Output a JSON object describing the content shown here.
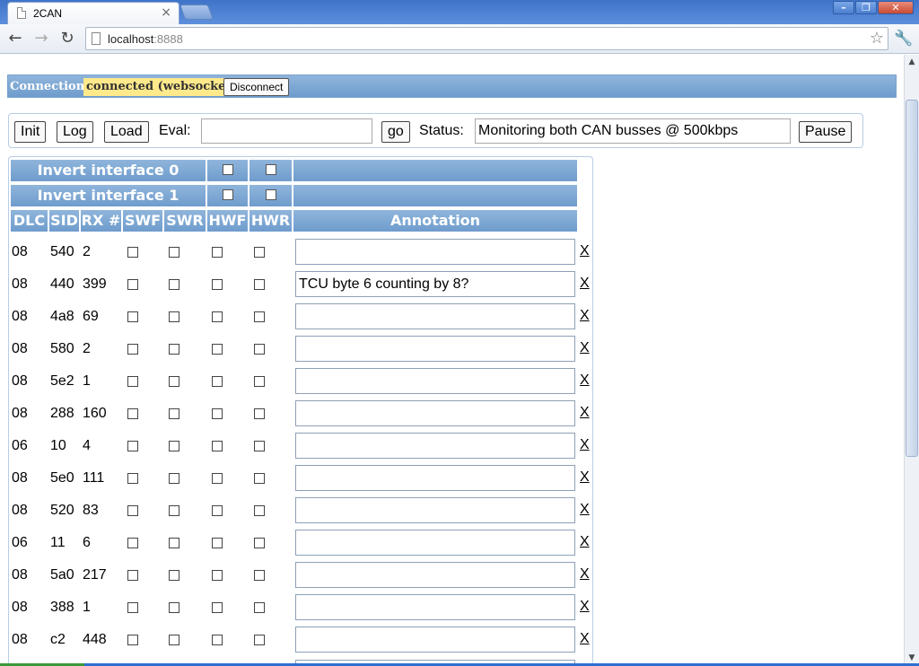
{
  "browser": {
    "tab_title": "2CAN",
    "tab_close": "×",
    "url_host": "localhost",
    "url_port": ":8888",
    "back": "←",
    "forward": "→",
    "reload": "↻",
    "star": "☆",
    "wrench": "🔧",
    "min": "–",
    "max": "❐",
    "close": "✕"
  },
  "connection": {
    "label": "Connection:",
    "status": "connected (websocket)",
    "button": "Disconnect"
  },
  "controls": {
    "init": "Init",
    "log": "Log",
    "load": "Load",
    "eval_label": "Eval:",
    "eval_value": "",
    "go": "go",
    "status_label": "Status:",
    "status_value": "Monitoring both CAN busses @ 500kbps",
    "pause": "Pause"
  },
  "table": {
    "invert0": "Invert interface 0",
    "invert1": "Invert interface 1",
    "headers": {
      "dlc": "DLC",
      "sid": "SID",
      "rx": "RX #",
      "swf": "SWF",
      "swr": "SWR",
      "hwf": "HWF",
      "hwr": "HWR",
      "annotation": "Annotation"
    },
    "delete_label": "X",
    "rows": [
      {
        "dlc": "08",
        "sid": "540",
        "rx": "2",
        "annotation": ""
      },
      {
        "dlc": "08",
        "sid": "440",
        "rx": "399",
        "annotation": "TCU byte 6 counting by 8?"
      },
      {
        "dlc": "08",
        "sid": "4a8",
        "rx": "69",
        "annotation": ""
      },
      {
        "dlc": "08",
        "sid": "580",
        "rx": "2",
        "annotation": ""
      },
      {
        "dlc": "08",
        "sid": "5e2",
        "rx": "1",
        "annotation": ""
      },
      {
        "dlc": "08",
        "sid": "288",
        "rx": "160",
        "annotation": ""
      },
      {
        "dlc": "06",
        "sid": "10",
        "rx": "4",
        "annotation": ""
      },
      {
        "dlc": "08",
        "sid": "5e0",
        "rx": "111",
        "annotation": ""
      },
      {
        "dlc": "08",
        "sid": "520",
        "rx": "83",
        "annotation": ""
      },
      {
        "dlc": "06",
        "sid": "11",
        "rx": "6",
        "annotation": ""
      },
      {
        "dlc": "08",
        "sid": "5a0",
        "rx": "217",
        "annotation": ""
      },
      {
        "dlc": "08",
        "sid": "388",
        "rx": "1",
        "annotation": ""
      },
      {
        "dlc": "08",
        "sid": "c2",
        "rx": "448",
        "annotation": ""
      }
    ]
  }
}
